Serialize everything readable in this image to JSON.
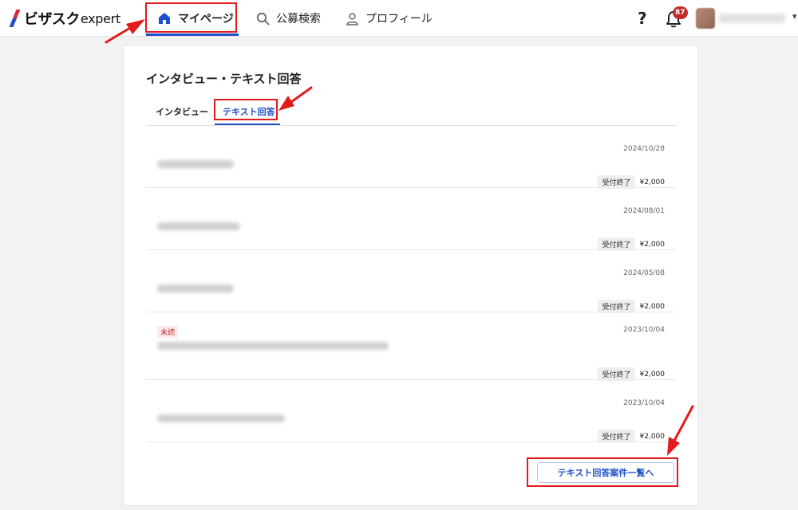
{
  "header": {
    "logo_main": "ビザスク",
    "logo_sub": "expert",
    "nav": [
      {
        "label": "マイページ",
        "icon": "home-icon"
      },
      {
        "label": "公募検索",
        "icon": "search-icon"
      },
      {
        "label": "プロフィール",
        "icon": "person-icon"
      }
    ],
    "help_label": "?",
    "notification_count": "87"
  },
  "main": {
    "title": "インタビュー・テキスト回答",
    "tabs": [
      {
        "label": "インタビュー",
        "active": false
      },
      {
        "label": "テキスト回答",
        "active": true
      }
    ],
    "rows": [
      {
        "date": "2024/10/28",
        "status": "受付終了",
        "price": "¥2,000",
        "unread": ""
      },
      {
        "date": "2024/08/01",
        "status": "受付終了",
        "price": "¥2,000",
        "unread": ""
      },
      {
        "date": "2024/05/08",
        "status": "受付終了",
        "price": "¥2,000",
        "unread": ""
      },
      {
        "date": "2023/10/04",
        "status": "受付終了",
        "price": "¥2,000",
        "unread": "未読"
      },
      {
        "date": "2023/10/04",
        "status": "受付終了",
        "price": "¥2,000",
        "unread": ""
      }
    ],
    "list_button_label": "テキスト回答案件一覧へ"
  },
  "colors": {
    "accent": "#1f4fc9",
    "annotation": "#e21b1b",
    "badge": "#c42a2a"
  }
}
